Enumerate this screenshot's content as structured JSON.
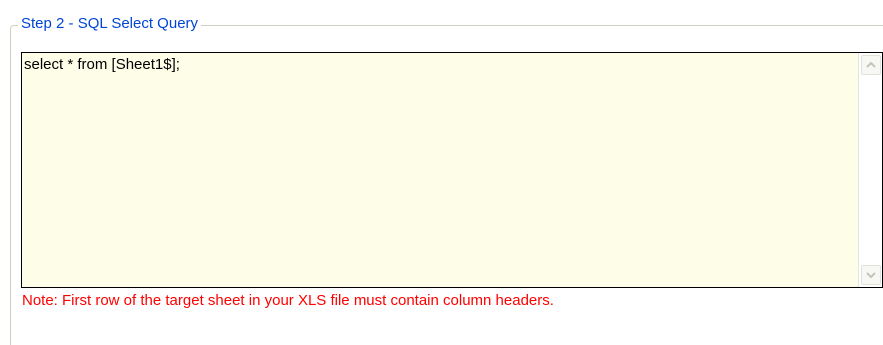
{
  "group": {
    "title": "Step 2 - SQL Select Query"
  },
  "query": {
    "value": "select * from [Sheet1$];"
  },
  "scrollbar": {
    "up_icon": "chevron-up-icon",
    "down_icon": "chevron-down-icon",
    "state": "disabled"
  },
  "note": {
    "text": "Note: First row of the target sheet in your XLS file must contain column headers."
  },
  "colors": {
    "title": "#0046d5",
    "note": "#ff0000",
    "query_background": "#fdfde8"
  }
}
